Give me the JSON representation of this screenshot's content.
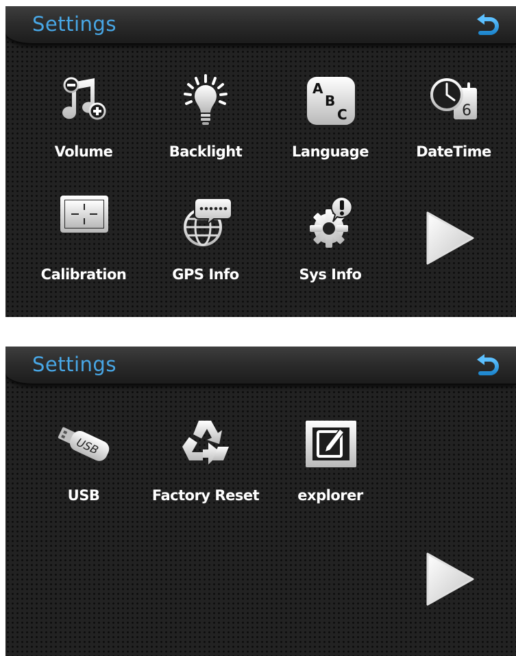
{
  "screens": [
    {
      "title": "Settings",
      "back_icon": "back-arrow-icon",
      "items": [
        {
          "label": "Volume",
          "icon": "music-note-volume-icon"
        },
        {
          "label": "Backlight",
          "icon": "light-bulb-icon"
        },
        {
          "label": "Language",
          "icon": "abc-icon"
        },
        {
          "label": "DateTime",
          "icon": "clock-calendar-icon"
        },
        {
          "label": "Calibration",
          "icon": "crosshair-icon"
        },
        {
          "label": "GPS Info",
          "icon": "globe-speech-icon"
        },
        {
          "label": "Sys Info",
          "icon": "gear-alert-icon"
        }
      ],
      "next_icon": "next-page-arrow-icon"
    },
    {
      "title": "Settings",
      "back_icon": "back-arrow-icon",
      "items": [
        {
          "label": "USB",
          "icon": "usb-drive-icon"
        },
        {
          "label": "Factory Reset",
          "icon": "recycle-icon"
        },
        {
          "label": "explorer",
          "icon": "edit-document-icon"
        }
      ],
      "next_icon": "next-page-arrow-icon"
    }
  ],
  "colors": {
    "title": "#48a7e6",
    "back_arrow": "#3a9ee0",
    "panel_bg": "#222222"
  }
}
